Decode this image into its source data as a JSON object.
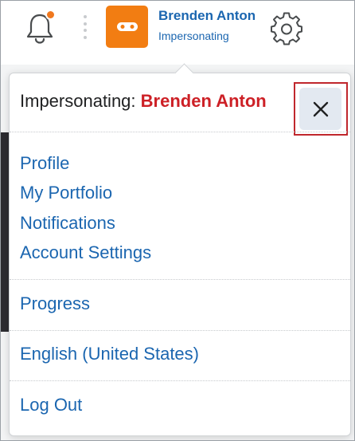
{
  "header": {
    "user_name": "Brenden Anton",
    "user_role": "Impersonating"
  },
  "dropdown": {
    "impersonating_label": "Impersonating:",
    "impersonated_user": "Brenden Anton",
    "links": {
      "profile": "Profile",
      "portfolio": "My Portfolio",
      "notifications": "Notifications",
      "account_settings": "Account Settings",
      "progress": "Progress",
      "language": "English (United States)",
      "logout": "Log Out"
    }
  },
  "icons": {
    "notifications": "bell-icon",
    "notification_indicator": "notification-dot",
    "more": "kebab-icon",
    "impersonation_avatar": "mask-icon",
    "settings": "gear-icon",
    "close": "close-icon"
  },
  "colors": {
    "link": "#1b66b0",
    "avatar_bg": "#f27d12",
    "notification_dot": "#f0781e",
    "impersonated_name": "#cd2026",
    "highlight_border": "#c0272d",
    "close_button_bg": "#e3e9f1"
  }
}
